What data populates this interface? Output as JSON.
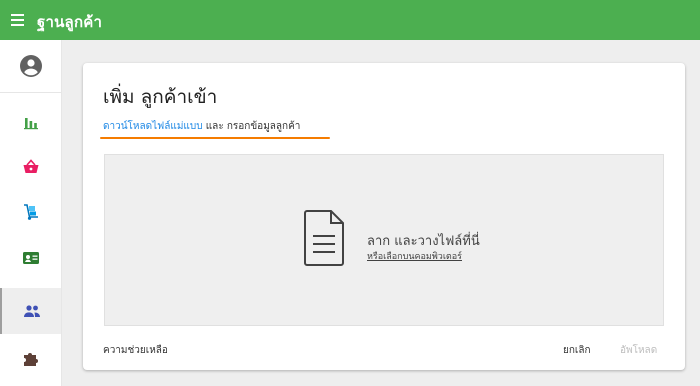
{
  "header": {
    "title": "ฐานลูกค้า"
  },
  "sidebar": {
    "items": [
      {
        "icon": "account-circle-icon"
      },
      {
        "icon": "bar-chart-icon",
        "color": "#43a047"
      },
      {
        "icon": "shopping-basket-icon",
        "color": "#e91e63"
      },
      {
        "icon": "hand-truck-icon",
        "color": "#039be5"
      },
      {
        "icon": "contact-card-icon",
        "color": "#2e7d32"
      },
      {
        "icon": "people-icon",
        "color": "#3f51b5",
        "active": true
      },
      {
        "icon": "puzzle-icon",
        "color": "#5d4037"
      }
    ]
  },
  "card": {
    "title": "เพิ่ม ลูกค้าเข้า",
    "download_link": "ดาวน์โหลดไฟล์แม่แบบ",
    "subtitle_rest": " และ กรอกข้อมูลลูกค้า",
    "dropzone": {
      "icon": "document-icon",
      "main_text": "ลาก และวางไฟล์ที่นี่",
      "sub_link": "หรือเลือกบนคอมพิวเตอร์"
    },
    "help": "ความช่วยเหลือ",
    "cancel": "ยกเลิก",
    "upload": "อัพโหลด"
  },
  "colors": {
    "brand": "#4caf50",
    "accent_link": "#1e88e5",
    "highlight": "#f57c00"
  }
}
